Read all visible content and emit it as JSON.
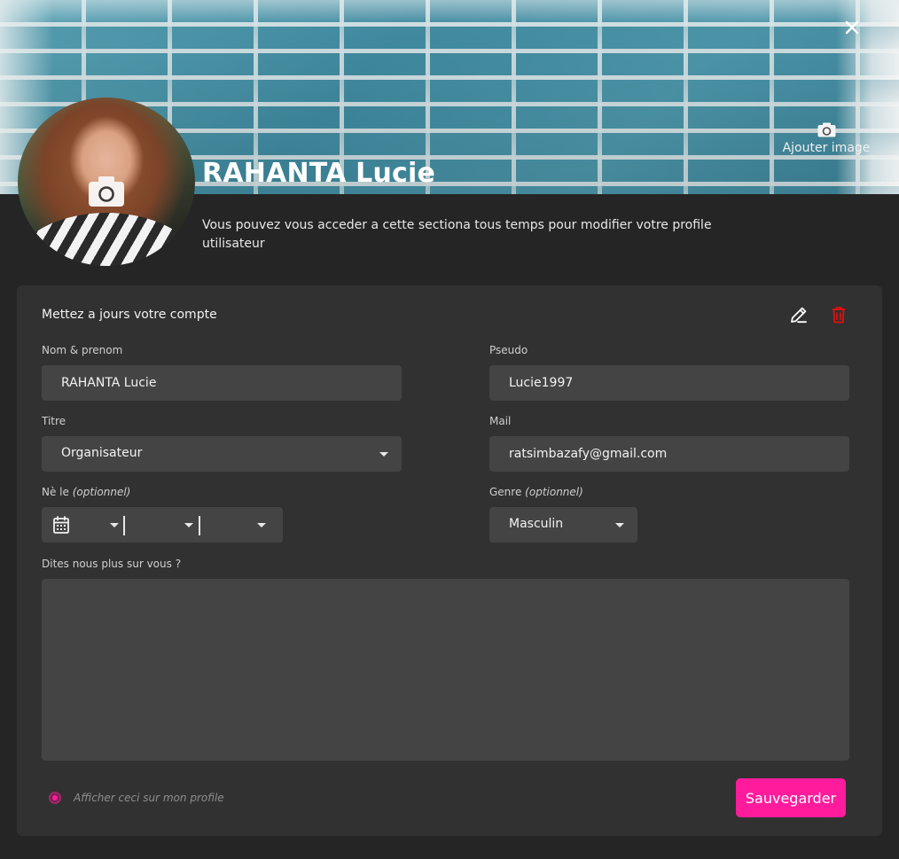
{
  "cover": {
    "add_image_label": "Ajouter image"
  },
  "profile": {
    "name": "RAHANTA Lucie",
    "description": "Vous pouvez vous acceder a cette sectiona tous temps pour modifier votre profile utilisateur"
  },
  "form": {
    "title": "Mettez a jours votre compte",
    "fullname": {
      "label": "Nom & prenom",
      "value": "RAHANTA Lucie"
    },
    "pseudo": {
      "label": "Pseudo",
      "value": "Lucie1997"
    },
    "title_field": {
      "label": "Titre",
      "value": "Organisateur"
    },
    "mail": {
      "label": "Mail",
      "value": "ratsimbazafy@gmail.com"
    },
    "birthdate": {
      "label": "Nè le",
      "optional": "(optionnel)"
    },
    "gender": {
      "label": "Genre",
      "optional": "(optionnel)",
      "value": "Masculin"
    },
    "about": {
      "label": "Dites nous plus sur vous ?",
      "value": ""
    },
    "show_on_profile_label": "Afficher ceci sur mon profile",
    "save_label": "Sauvegarder"
  },
  "colors": {
    "accent": "#ff1c9c",
    "delete": "#e01010",
    "background": "#252525",
    "card": "#313131",
    "input": "#444444"
  },
  "icons": {
    "close": "close-icon",
    "camera": "camera-icon",
    "edit": "edit-icon",
    "delete": "trash-icon",
    "calendar": "calendar-icon",
    "dropdown": "chevron-down-icon"
  }
}
